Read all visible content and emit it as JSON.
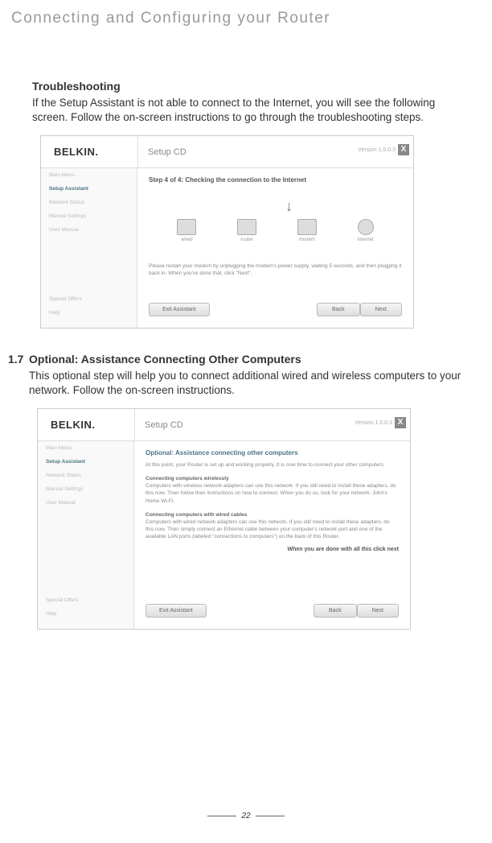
{
  "header": "Connecting and Configuring your Router",
  "section1": {
    "title": "Troubleshooting",
    "body": "If the Setup Assistant is not able to connect to the Internet, you will see the following screen. Follow the on-screen instructions to go through the troubleshooting steps."
  },
  "screenshot1": {
    "logo": "BELKIN.",
    "title": "Setup CD",
    "version": "Version 1.0.0.3",
    "close": "X",
    "sidebar": {
      "items": [
        "Main Menu",
        "Setup Assistant",
        "Network Status",
        "Manual Settings",
        "User Manual"
      ],
      "bottom": [
        "Special Offers",
        "Help"
      ]
    },
    "step_title": "Step 4 of 4: Checking the connection to the Internet",
    "devices": [
      "wired",
      "router",
      "modem",
      "internet"
    ],
    "instruction": "Please restart your modem by unplugging the modem's power supply, waiting 5 seconds, and then plugging it back in. When you've done that, click \"Next\".",
    "buttons": {
      "exit": "Exit Assistant",
      "back": "Back",
      "next": "Next"
    }
  },
  "section2": {
    "number": "1.7",
    "title": "Optional: Assistance Connecting Other Computers",
    "body": "This optional step will help you to connect additional wired and wireless computers to your network. Follow the on-screen instructions."
  },
  "screenshot2": {
    "logo": "BELKIN.",
    "title": "Setup CD",
    "version": "Version 1.0.0.3",
    "close": "X",
    "sidebar": {
      "items": [
        "Main Menu",
        "Setup Assistant",
        "Network Status",
        "Manual Settings",
        "User Manual"
      ],
      "bottom": [
        "Special Offers",
        "Help"
      ]
    },
    "optional_title": "Optional: Assistance connecting other computers",
    "para1": "At this point, your Router is set up and working properly. It is now time to connect your other computers.",
    "para2_head": "Connecting computers wirelessly",
    "para2": "Computers with wireless network adapters can use this network. If you still need to install these adapters, do this now. Then follow their instructions on how to connect. When you do so, look for your network: John's Home Wi-Fi.",
    "para3_head": "Connecting computers with wired cables",
    "para3": "Computers with wired network adapters can use this network. If you still need to install these adapters, do this now. Then simply connect an Ethernet cable between your computer's network port and one of the available LAN ports (labeled \"connections to computers\") on the back of this Router.",
    "done_line": "When you are done with all this click next",
    "buttons": {
      "exit": "Exit Assistant",
      "back": "Back",
      "next": "Next"
    }
  },
  "page_number": "22"
}
